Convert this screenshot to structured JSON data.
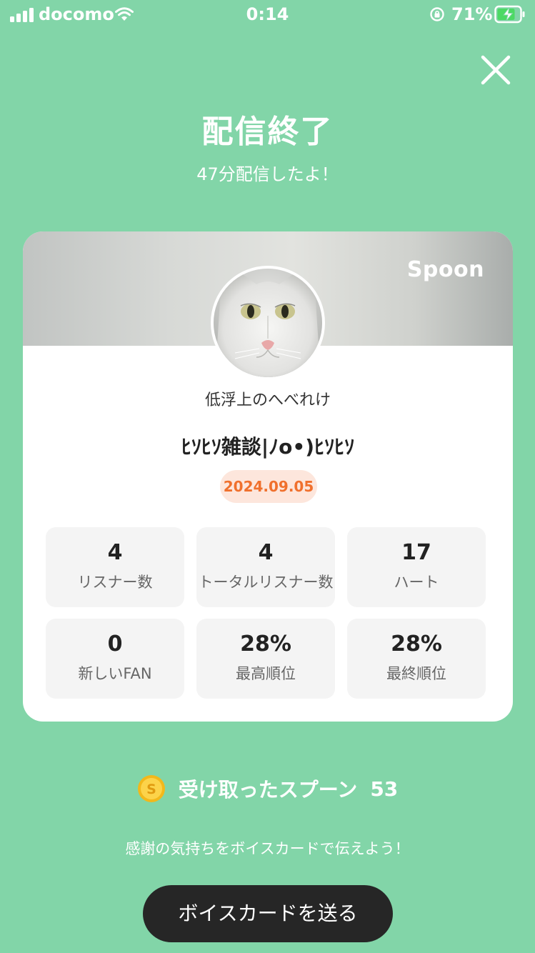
{
  "status_bar": {
    "carrier": "docomo",
    "time": "0:14",
    "battery_percent": "71%"
  },
  "header": {
    "title": "配信終了",
    "subtitle": "47分配信したよ！"
  },
  "card": {
    "brand": "Spoon",
    "username": "低浮上のへべれけ",
    "show_title": "ﾋｿﾋｿ雑談|ﾉo•)ﾋｿﾋｿ",
    "date": "2024.09.05",
    "stats": [
      {
        "value": "4",
        "label": "リスナー数"
      },
      {
        "value": "4",
        "label": "トータルリスナー数"
      },
      {
        "value": "17",
        "label": "ハート"
      },
      {
        "value": "0",
        "label": "新しいFAN"
      },
      {
        "value": "28%",
        "label": "最高順位"
      },
      {
        "value": "28%",
        "label": "最終順位"
      }
    ]
  },
  "spoons": {
    "label": "受け取ったスプーン",
    "count": "53",
    "coin_letter": "S"
  },
  "footer": {
    "thanks_text": "感謝の気持ちをボイスカードで伝えよう！",
    "send_button": "ボイスカードを送る"
  },
  "colors": {
    "background": "#82d5a8",
    "date_badge_bg": "#fde6dc",
    "date_badge_text": "#f0702d",
    "button_bg": "#262626"
  }
}
